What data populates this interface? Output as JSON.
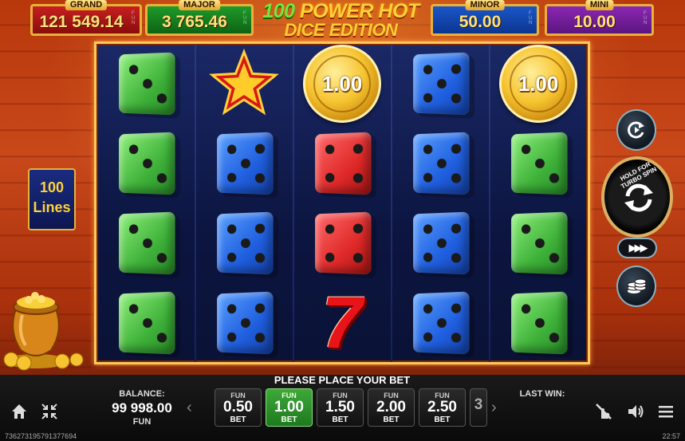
{
  "jackpots": {
    "grand": {
      "label": "GRAND",
      "value": "121 549.14",
      "tag": "FUN"
    },
    "major": {
      "label": "MAJOR",
      "value": "3 765.46",
      "tag": "FUN"
    },
    "minor": {
      "label": "MINOR",
      "value": "50.00",
      "tag": "FUN"
    },
    "mini": {
      "label": "MINI",
      "value": "10.00",
      "tag": "FUN"
    }
  },
  "logo": {
    "line1_number": "100",
    "line1_text": "POWER HOT",
    "line2": "DICE EDITION"
  },
  "lines": {
    "count": "100",
    "label": "Lines"
  },
  "reels": [
    [
      "die-green-3",
      "die-green-3",
      "die-green-3",
      "die-green-3"
    ],
    [
      "star",
      "die-blue-5",
      "die-blue-5",
      "die-blue-5"
    ],
    [
      "coin",
      "die-red-4",
      "die-red-4",
      "seven"
    ],
    [
      "die-blue-5",
      "die-blue-5",
      "die-blue-5",
      "die-blue-5"
    ],
    [
      "coin",
      "die-green-3",
      "die-green-3",
      "die-green-3"
    ]
  ],
  "coin_values": [
    "1.00",
    "1.00"
  ],
  "message": "PLEASE PLACE YOUR BET",
  "balance": {
    "label": "BALANCE:",
    "value": "99 998.00",
    "currency": "FUN"
  },
  "last_win": {
    "label": "LAST WIN:"
  },
  "bets": [
    {
      "tag": "FUN",
      "value": "0.50",
      "label": "BET",
      "active": false
    },
    {
      "tag": "FUN",
      "value": "1.00",
      "label": "BET",
      "active": true
    },
    {
      "tag": "FUN",
      "value": "1.50",
      "label": "BET",
      "active": false
    },
    {
      "tag": "FUN",
      "value": "2.00",
      "label": "BET",
      "active": false
    },
    {
      "tag": "FUN",
      "value": "2.50",
      "label": "BET",
      "active": false
    }
  ],
  "bet_partial": "3",
  "turbo": {
    "text": "HOLD FOR TURBO SPIN"
  },
  "icons": {
    "home": "home-icon",
    "fullscreen": "fullscreen-icon",
    "autoplay": "autoplay-icon",
    "spin": "spin-icon",
    "fast_forward": "fast-forward-icon",
    "coins": "coin-stack-icon",
    "no_touch": "touch-off-icon",
    "sound": "sound-icon",
    "menu": "menu-icon"
  },
  "footer": {
    "session_id": "7362731957913776​94",
    "time": "22:57"
  },
  "colors": {
    "accent_gold": "#e8b13a",
    "active_bet": "#3fa83a"
  }
}
